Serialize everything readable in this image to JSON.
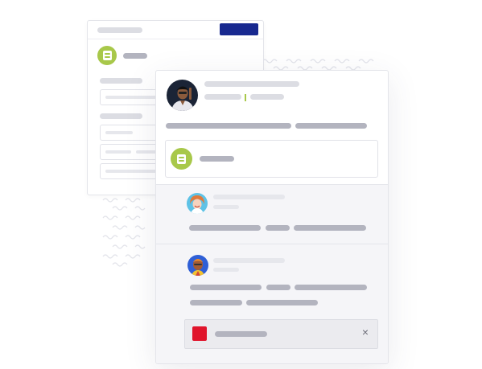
{
  "colors": {
    "background": "#ffffff",
    "accent_green": "#a8c84a",
    "primary_button": "#17288f",
    "attachment_red": "#e0142b",
    "placeholder_bar": "#b3b4bf",
    "placeholder_bar_light": "#dcdde3"
  },
  "icons": {
    "document": "document-icon",
    "close": "close-icon",
    "attachment": "attachment-icon"
  },
  "attachment": {
    "close_glyph": "×"
  }
}
